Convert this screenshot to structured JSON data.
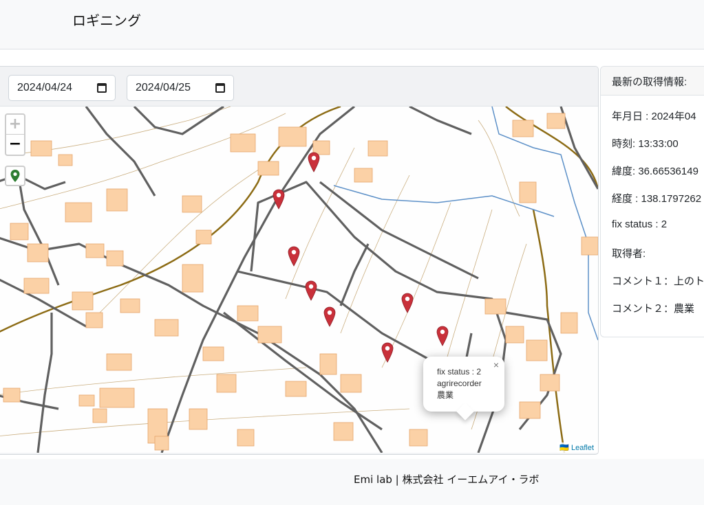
{
  "header": {
    "title": "ロギニング"
  },
  "filters": {
    "start_date": "2024/04/24",
    "end_date": "2024/04/25"
  },
  "map": {
    "zoom_in": "+",
    "zoom_out": "−",
    "popup": {
      "close": "×",
      "line1": "fix status : 2",
      "line2": "agrirecorder",
      "line3": "農業"
    },
    "attribution": "Leaflet",
    "marker_color": "#c9303a",
    "locate_color": "#2e7d32"
  },
  "info": {
    "heading": "最新の取得情報:",
    "date": "年月日 : 2024年04",
    "time": "時刻: 13:33:00",
    "lat": "緯度: 36.66536149",
    "lng": "経度 : 138.1797262",
    "fix": "fix status : 2",
    "user": "取得者:",
    "comment1": "コメント１：上のト",
    "comment2": "コメント２：農業"
  },
  "footer": {
    "text": "Emi lab | 株式会社 イーエムアイ・ラボ"
  }
}
